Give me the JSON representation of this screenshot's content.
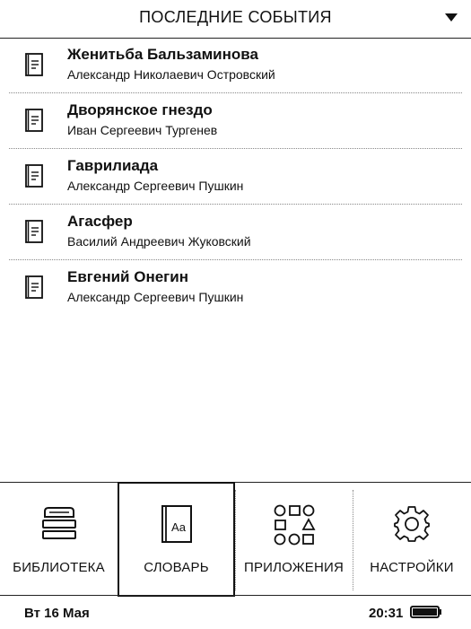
{
  "header": {
    "title": "ПОСЛЕДНИЕ СОБЫТИЯ"
  },
  "books": [
    {
      "title": "Женитьба Бальзаминова",
      "author": "Александр Николаевич Островский"
    },
    {
      "title": "Дворянское гнездо",
      "author": "Иван Сергеевич Тургенев"
    },
    {
      "title": "Гаврилиада",
      "author": "Александр Сергеевич Пушкин"
    },
    {
      "title": "Агасфер",
      "author": "Василий Андреевич Жуковский"
    },
    {
      "title": "Евгений Онегин",
      "author": "Александр Сергеевич Пушкин"
    }
  ],
  "nav": {
    "library": {
      "label": "БИБЛИОТЕКА",
      "icon": "books-stack-icon"
    },
    "dictionary": {
      "label": "СЛОВАРЬ",
      "icon": "dictionary-book-icon",
      "icon_text": "Aa",
      "active": true
    },
    "apps": {
      "label": "ПРИЛОЖЕНИЯ",
      "icon": "apps-shapes-icon"
    },
    "settings": {
      "label": "НАСТРОЙКИ",
      "icon": "gear-icon"
    }
  },
  "status": {
    "date": "Вт 16 Мая",
    "time": "20:31",
    "battery_level": 1.0
  },
  "colors": {
    "ink": "#111111",
    "background": "#ffffff"
  }
}
